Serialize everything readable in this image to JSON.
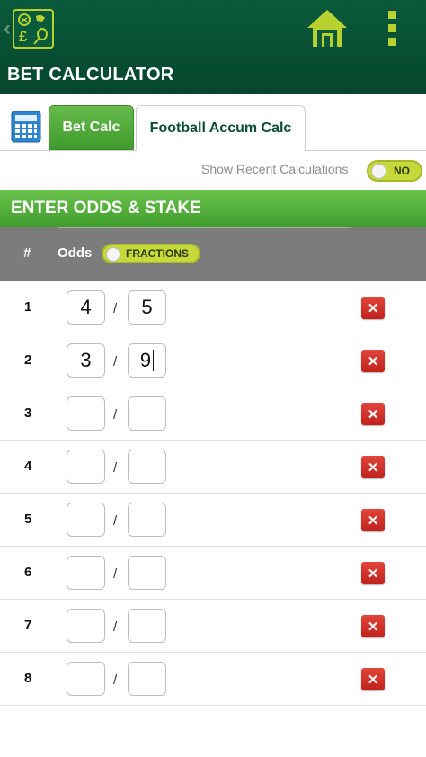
{
  "appbar": {
    "title": "BET CALCULATOR",
    "logo_icon": "sports-betting-logo-icon",
    "home_icon": "home-icon",
    "menu_icon": "kebab-menu-icon",
    "back_icon": "chevron-left-icon"
  },
  "tabs": [
    {
      "label": "Bet Calc",
      "active": true
    },
    {
      "label": "Football Accum Calc",
      "active": false
    }
  ],
  "recent": {
    "label": "Show Recent Calculations",
    "toggle_label": "NO"
  },
  "section": {
    "title": "ENTER ODDS & STAKE"
  },
  "table": {
    "col_number": "#",
    "col_odds": "Odds",
    "odds_format": "FRACTIONS",
    "rows": [
      {
        "num": "1",
        "numerator": "4",
        "denominator": "5"
      },
      {
        "num": "2",
        "numerator": "3",
        "denominator": "9"
      },
      {
        "num": "3",
        "numerator": "",
        "denominator": ""
      },
      {
        "num": "4",
        "numerator": "",
        "denominator": ""
      },
      {
        "num": "5",
        "numerator": "",
        "denominator": ""
      },
      {
        "num": "6",
        "numerator": "",
        "denominator": ""
      },
      {
        "num": "7",
        "numerator": "",
        "denominator": ""
      },
      {
        "num": "8",
        "numerator": "",
        "denominator": ""
      }
    ],
    "separator": "/",
    "delete_glyph": "✕"
  },
  "colors": {
    "appbar": "#0a5a3c",
    "accent_green": "#4fae36",
    "toggle_lime": "#c6d83a",
    "header_gray": "#7c7c7c",
    "delete_red": "#d2312a"
  }
}
